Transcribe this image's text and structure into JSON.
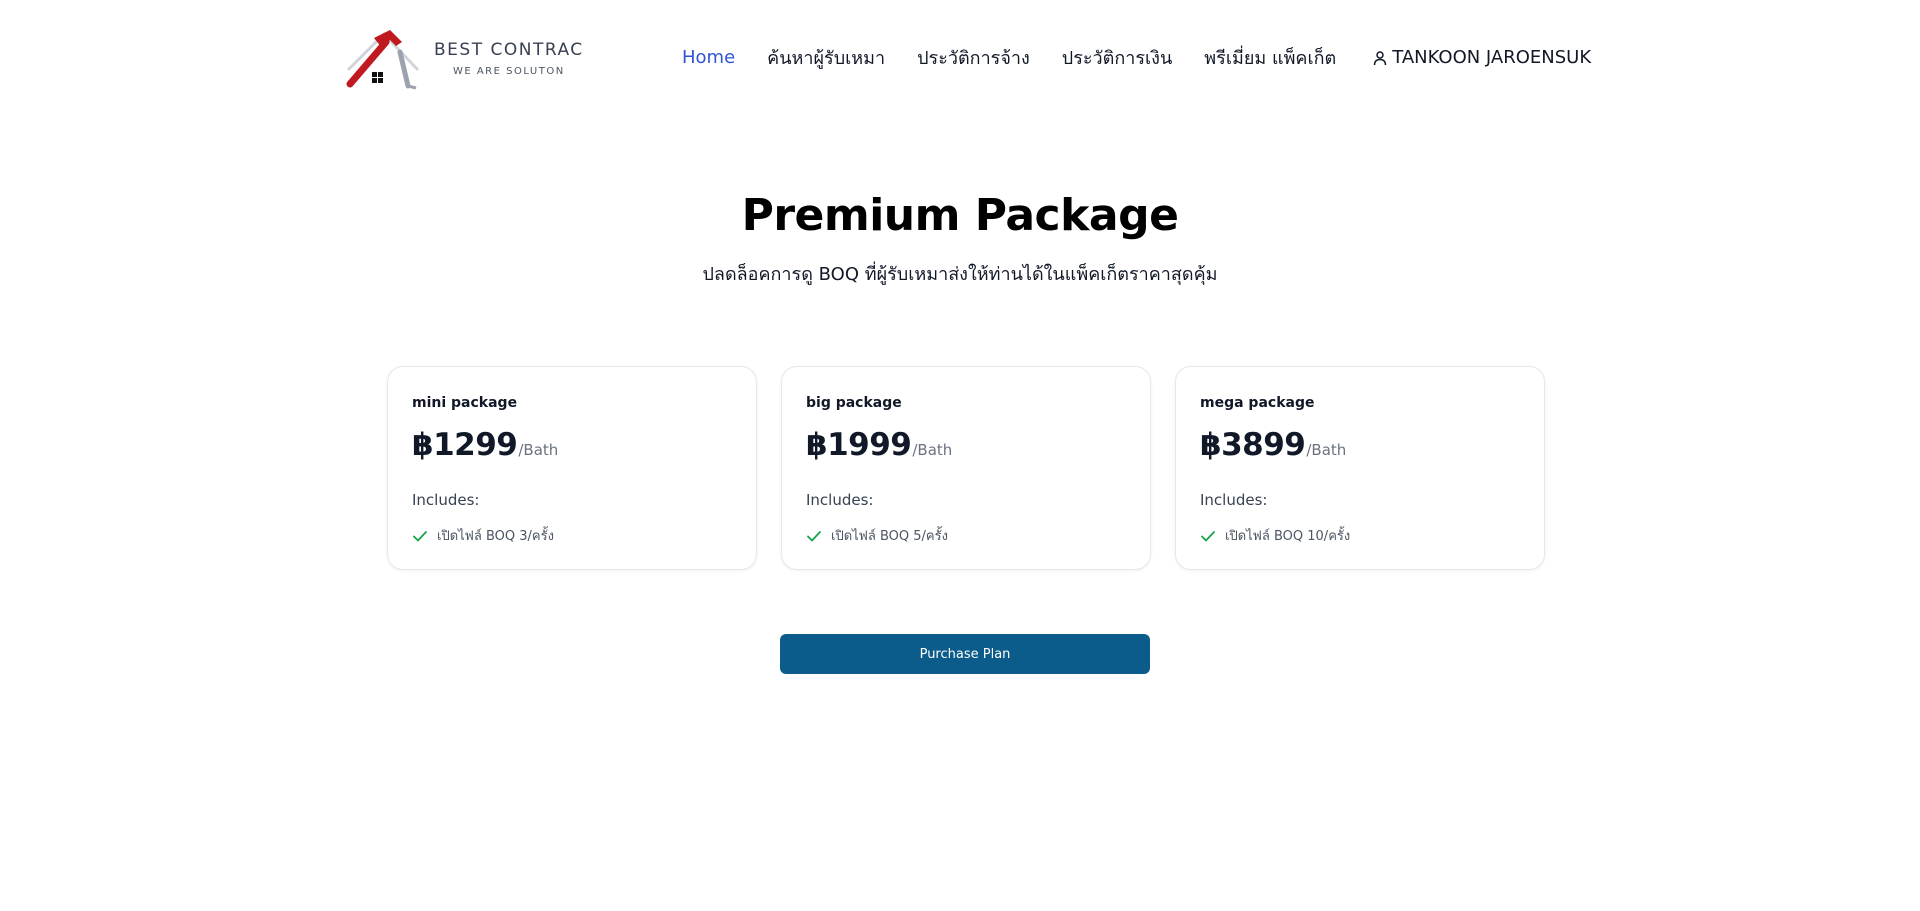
{
  "header": {
    "brand": "BEST CONTRAC",
    "tagline": "WE ARE SOLUTON",
    "nav": [
      {
        "label": "Home",
        "active": true
      },
      {
        "label": "ค้นหาผู้รับเหมา"
      },
      {
        "label": "ประวัติการจ้าง"
      },
      {
        "label": "ประวัติการเงิน"
      },
      {
        "label": "พรีเมี่ยม แพ็คเก็ต"
      }
    ],
    "user": {
      "name": "TANKOON JAROENSUK",
      "icon": "user-icon"
    }
  },
  "hero": {
    "title": "Premium Package",
    "subtitle": "ปลดล็อคการดู BOQ ที่ผู้รับเหมาส่งให้ท่านได้ในแพ็คเก็ตราคาสุดคุ้ม"
  },
  "packages": [
    {
      "name": "mini package",
      "price": "฿1299",
      "unit": "/Bath",
      "includes_label": "Includes:",
      "feature": "เปิดไฟล์ BOQ 3/ครั้ง"
    },
    {
      "name": "big package",
      "price": "฿1999",
      "unit": "/Bath",
      "includes_label": "Includes:",
      "feature": "เปิดไฟล์ BOQ 5/ครั้ง"
    },
    {
      "name": "mega package",
      "price": "฿3899",
      "unit": "/Bath",
      "includes_label": "Includes:",
      "feature": "เปิดไฟล์ BOQ 10/ครั้ง"
    }
  ],
  "purchase_label": "Purchase Plan",
  "colors": {
    "nav_active": "#2f55d4",
    "button": "#0b5c8a",
    "check": "#16a34a",
    "logo_red": "#c0191f"
  }
}
